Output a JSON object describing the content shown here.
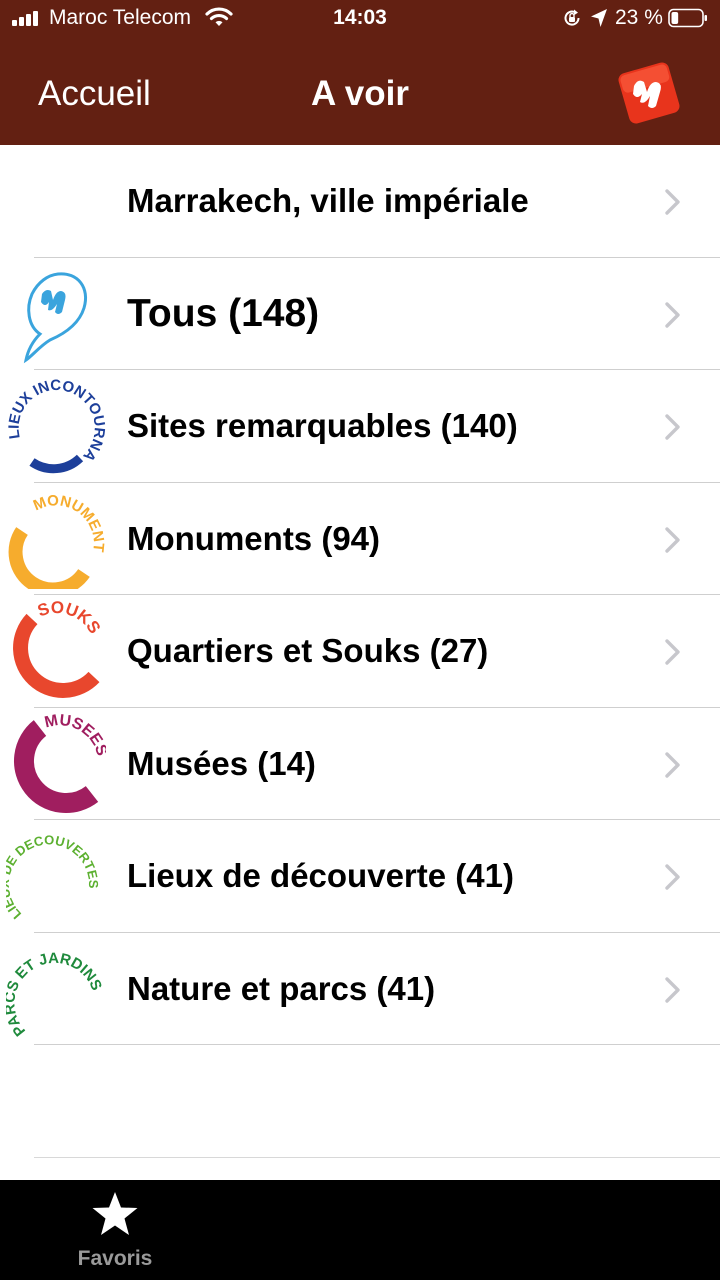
{
  "status_bar": {
    "carrier": "Maroc Telecom",
    "time": "14:03",
    "battery_percent": "23 %",
    "battery_level": 0.23
  },
  "nav": {
    "back_label": "Accueil",
    "title": "A voir",
    "logo_icon": "brand-logo-icon"
  },
  "colors": {
    "bar_brown": "#632012",
    "logo_red": "#e8341c",
    "incontournables_blue": "#1d3f9a",
    "monuments_orange": "#f6ac2d",
    "souks_red": "#e8472d",
    "musees_purple": "#a01e5f",
    "decouverte_green": "#5cb030",
    "parcs_green": "#1f8a3c"
  },
  "list": {
    "items": [
      {
        "label": "Marrakech, ville impériale",
        "icon": ""
      },
      {
        "label": "Tous (148)",
        "icon": "speech-bubble-logo-icon"
      },
      {
        "label": "Sites remarquables (140)",
        "icon": "lieux-incontournables-icon",
        "icon_text": "LIEUX INCONTOURNABLES"
      },
      {
        "label": "Monuments (94)",
        "icon": "monuments-icon",
        "icon_text": "MONUMENTS"
      },
      {
        "label": "Quartiers et Souks (27)",
        "icon": "souks-icon",
        "icon_text": "SOUKS"
      },
      {
        "label": "Musées (14)",
        "icon": "musees-icon",
        "icon_text": "MUSEES"
      },
      {
        "label": "Lieux de découverte (41)",
        "icon": "lieux-de-decouvertes-icon",
        "icon_text": "LIEUX DE DECOUVERTES"
      },
      {
        "label": "Nature et parcs (41)",
        "icon": "parcs-et-jardins-icon",
        "icon_text": "PARCS ET JARDINS"
      }
    ]
  },
  "tabbar": {
    "favoris_label": "Favoris",
    "favoris_icon": "star-icon"
  }
}
